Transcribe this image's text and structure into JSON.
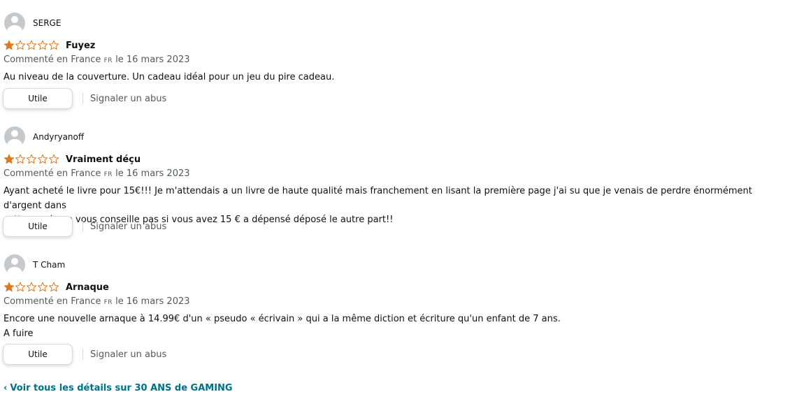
{
  "reviews": [
    {
      "author": "SERGE",
      "rating": 1,
      "rating_max": 5,
      "title": "Fuyez",
      "meta_prefix": "Commenté en France",
      "lang_code": "FR",
      "meta_suffix": "le 16 mars 2023",
      "body_lines": [
        "Au niveau de la couverture. Un cadeau idéal pour un jeu du pire cadeau."
      ],
      "helpful_label": "Utile",
      "report_label": "Signaler un abus"
    },
    {
      "author": "Andyryanoff",
      "rating": 1,
      "rating_max": 5,
      "title": "Vraiment déçu",
      "meta_prefix": "Commenté en France",
      "lang_code": "FR",
      "meta_suffix": "le 16 mars 2023",
      "body_lines": [
        "Ayant acheté le livre pour 15€!!! Je m'attendais a un livre de haute qualité mais franchement en lisant la première page j'ai su que je venais de perdre énormément d'argent dans",
        "cette m... Je ne vous conseille pas si vous avez 15 € a dépensé déposé le autre part!!"
      ],
      "helpful_label": "Utile",
      "report_label": "Signaler un abus"
    },
    {
      "author": "T Cham",
      "rating": 1,
      "rating_max": 5,
      "title": "Arnaque",
      "meta_prefix": "Commenté en France",
      "lang_code": "FR",
      "meta_suffix": "le 16 mars 2023",
      "body_lines": [
        "Encore une nouvelle arnaque à 14.99€ d'un « pseudo « écrivain » qui a la même diction et écriture qu'un enfant de 7 ans.",
        "A fuire"
      ],
      "helpful_label": "Utile",
      "report_label": "Signaler un abus"
    }
  ],
  "footer": {
    "chevron": "‹",
    "see_all_label": "Voir tous les détails sur 30 ANS de GAMING"
  },
  "colors": {
    "star_fill": "#de7921",
    "link": "#007185",
    "muted_text": "#565959",
    "avatar": "#c6c9cc"
  }
}
